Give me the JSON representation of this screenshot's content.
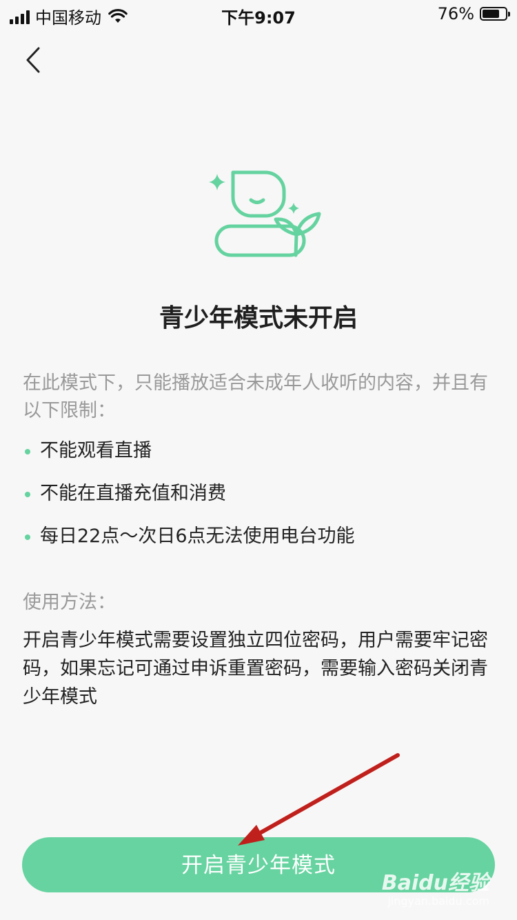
{
  "status_bar": {
    "carrier": "中国移动",
    "time": "下午9:07",
    "battery": "76%",
    "battery_level": 0.76
  },
  "nav": {
    "back_icon": "chevron-left-icon"
  },
  "hero": {
    "icon": "youth-mode-illustration",
    "accent_color": "#65d3a0"
  },
  "title": "青少年模式未开启",
  "intro": "在此模式下，只能播放适合未成年人收听的内容，并且有以下限制：",
  "rules": [
    "不能观看直播",
    "不能在直播充值和消费",
    "每日22点～次日6点无法使用电台功能"
  ],
  "usage": {
    "label": "使用方法：",
    "text": "开启青少年模式需要设置独立四位密码，用户需要牢记密码，如果忘记可通过申诉重置密码，需要输入密码关闭青少年模式"
  },
  "cta": {
    "label": "开启青少年模式",
    "color": "#66d3a0"
  },
  "annotation": {
    "arrow_color": "#c0201c"
  },
  "watermark": {
    "main": "Baidu经验",
    "sub": "jingyan.baidu.com"
  }
}
